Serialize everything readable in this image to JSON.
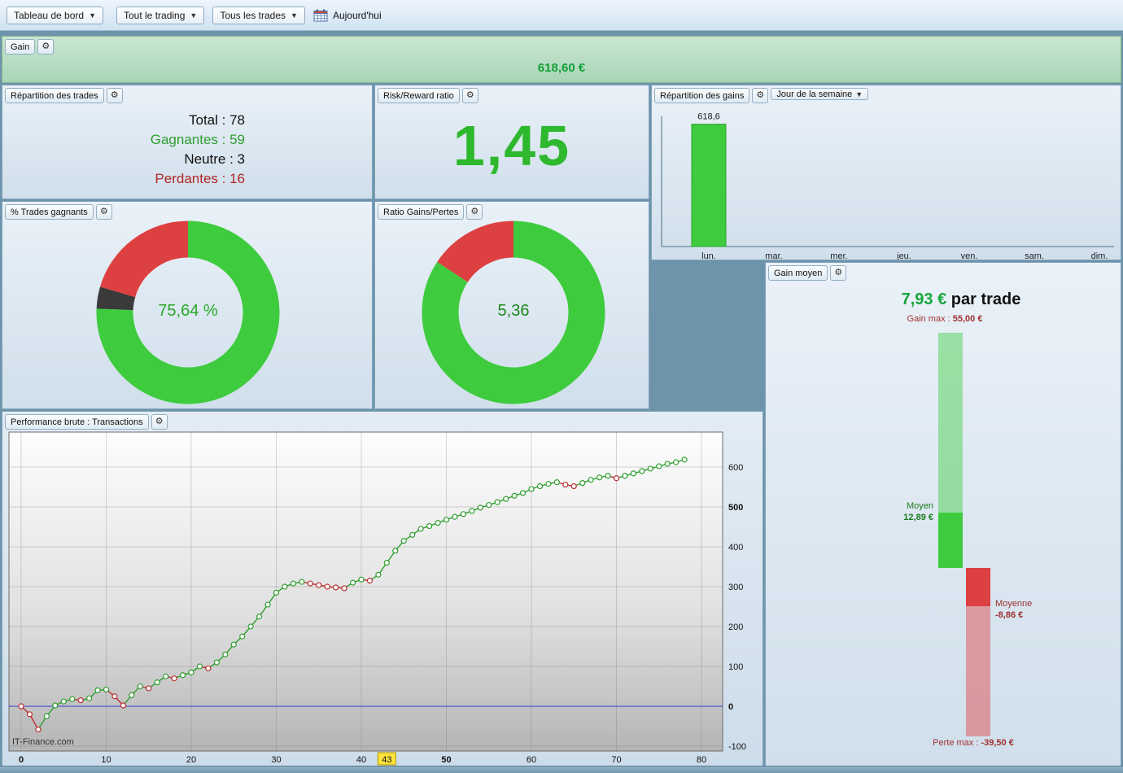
{
  "colors": {
    "green": "#3ecc3e",
    "red": "#dd4040",
    "dark": "#3a3a3a",
    "page_bg": "#6e94ab",
    "gain_text": "#12a038",
    "line_green": "#2f9e2f",
    "line_red": "#b83030"
  },
  "toolbar": {
    "dashboard_label": "Tableau de bord",
    "trading_label": "Tout le trading",
    "trades_label": "Tous les trades",
    "today_label": "Aujourd'hui"
  },
  "gain": {
    "title": "Gain",
    "value": "618,60 €"
  },
  "stats": {
    "title": "Répartition des trades",
    "lines": [
      "Total : 78",
      "Gagnantes : 59",
      "Neutre : 3",
      "Perdantes : 16"
    ]
  },
  "risk_reward": {
    "title": "Risk/Reward ratio",
    "value": "1,45"
  },
  "gains_by_day": {
    "title": "Répartition des gains",
    "filter_label": "Jour de la semaine",
    "chart": {
      "type": "bar",
      "categories": [
        "lun.",
        "mar.",
        "mer.",
        "jeu.",
        "ven.",
        "sam.",
        "dim."
      ],
      "values": [
        618.6,
        0,
        0,
        0,
        0,
        0,
        0
      ],
      "bar_label": "618,6",
      "ylim": [
        0,
        650
      ]
    }
  },
  "pct_winning": {
    "title": "% Trades gagnants",
    "center_label": "75,64 %",
    "chart": {
      "type": "pie",
      "segments": [
        {
          "name": "gagnantes",
          "pct": 75.64,
          "color": "#3ecc3e"
        },
        {
          "name": "neutres",
          "pct": 3.85,
          "color": "#3a3a3a"
        },
        {
          "name": "perdantes",
          "pct": 20.51,
          "color": "#dd4040"
        }
      ]
    }
  },
  "ratio_gains_pertes": {
    "title": "Ratio Gains/Pertes",
    "center_label": "5,36",
    "chart": {
      "type": "pie",
      "segments": [
        {
          "name": "gains",
          "pct": 84.28,
          "color": "#3ecc3e"
        },
        {
          "name": "pertes",
          "pct": 15.72,
          "color": "#dd4040"
        }
      ]
    }
  },
  "gain_moyen": {
    "title": "Gain moyen",
    "headline_value": "7,93 €",
    "headline_suffix": " par trade",
    "gain_max_label": "Gain max : ",
    "gain_max_value": "55,00 €",
    "moyen_label": "Moyen",
    "moyen_value": "12,89 €",
    "moyenne_label": "Moyenne",
    "moyenne_value": "-8,86 €",
    "perte_max_label": "Perte max : ",
    "perte_max_value": "-39,50 €",
    "chart": {
      "type": "waterfall",
      "gain_max": 55.0,
      "gain_moyen": 12.89,
      "perte_moyenne": -8.86,
      "perte_max": -39.5,
      "unit": "€"
    }
  },
  "performance": {
    "title": "Performance brute : Transactions",
    "watermark": "IT-Finance.com",
    "chart": {
      "type": "line",
      "x_ticks": [
        0,
        10,
        20,
        30,
        40,
        50,
        60,
        70,
        80
      ],
      "y_ticks": [
        600,
        500,
        400,
        300,
        200,
        100,
        0,
        -100
      ],
      "xlim": [
        0,
        83
      ],
      "ylim": [
        -110,
        690
      ],
      "highlight": 43,
      "values": [
        0,
        -20,
        -58,
        -25,
        2,
        12,
        18,
        15,
        20,
        40,
        42,
        25,
        2,
        28,
        50,
        45,
        60,
        75,
        70,
        78,
        85,
        100,
        95,
        110,
        130,
        155,
        175,
        200,
        225,
        255,
        285,
        300,
        308,
        312,
        308,
        304,
        300,
        298,
        296,
        310,
        318,
        315,
        330,
        360,
        390,
        415,
        430,
        445,
        452,
        460,
        468,
        475,
        482,
        490,
        498,
        505,
        512,
        520,
        528,
        535,
        545,
        552,
        558,
        562,
        556,
        552,
        560,
        568,
        574,
        578,
        572,
        578,
        584,
        590,
        596,
        602,
        608,
        612,
        618.6
      ]
    }
  }
}
